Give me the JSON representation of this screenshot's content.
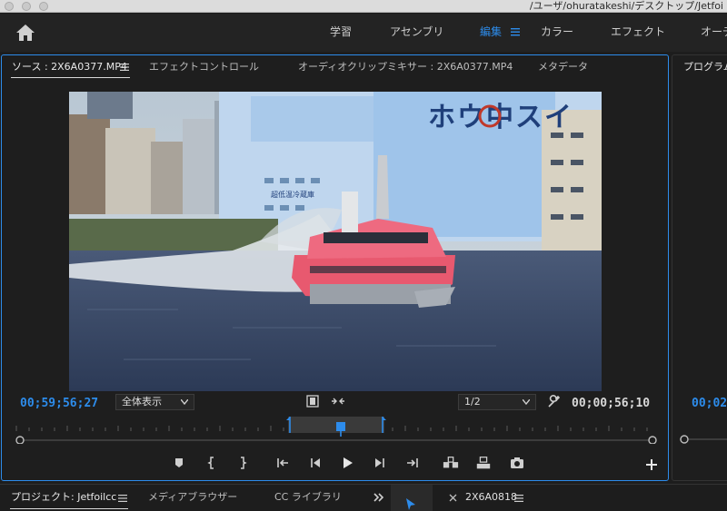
{
  "window": {
    "title": "/ユーザ/ohuratakeshi/デスクトップ/Jetfoi"
  },
  "workspaces": [
    {
      "label": "学習",
      "active": false
    },
    {
      "label": "アセンブリ",
      "active": false
    },
    {
      "label": "編集",
      "active": true
    },
    {
      "label": "カラー",
      "active": false
    },
    {
      "label": "エフェクト",
      "active": false
    },
    {
      "label": "オーデ",
      "active": false
    }
  ],
  "source_panel": {
    "tabs": [
      {
        "label": "ソース : 2X6A0377.MP4",
        "active": true
      },
      {
        "label": "エフェクトコントロール",
        "active": false
      },
      {
        "label": "オーディオクリップミキサー : 2X6A0377.MP4",
        "active": false
      },
      {
        "label": "メタデータ",
        "active": false
      }
    ],
    "timecode_in": "00;59;56;27",
    "fit_select": "全体表示",
    "resolution_select": "1/2",
    "timecode_out": "00;00;56;10",
    "video_signage": "ホウ中スイ",
    "video_sub_sign": "超低温冷蔵庫"
  },
  "program_panel": {
    "tab_label": "プログラム",
    "timecode": "00;02;"
  },
  "bottom_panel": {
    "tabs": [
      {
        "label": "プロジェクト: Jetfoilcc",
        "active": true
      },
      {
        "label": "メディアブラウザー",
        "active": false
      },
      {
        "label": "CC ライブラリ",
        "active": false
      }
    ],
    "sequence_tab": "2X6A0818"
  },
  "colors": {
    "accent": "#2d8ceb",
    "panel_bg": "#1e1e1e"
  }
}
